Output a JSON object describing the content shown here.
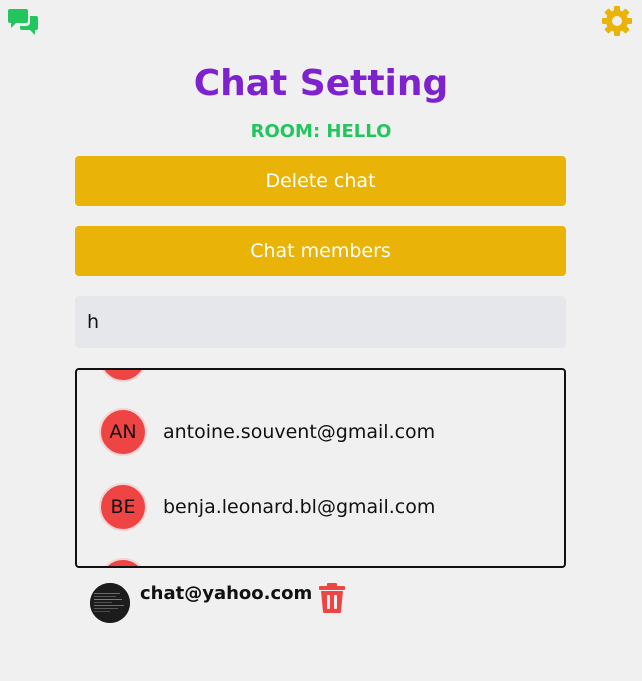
{
  "header": {
    "title": "Chat Setting",
    "room_label": "ROOM: HELLO",
    "left_icon": "chat-bubbles-icon",
    "right_icon": "gear-icon"
  },
  "actions": {
    "delete_label": "Delete chat",
    "members_label": "Chat members"
  },
  "search": {
    "value": "h"
  },
  "members": [
    {
      "initials": "",
      "email": ""
    },
    {
      "initials": "AN",
      "email": "antoine.souvent@gmail.com"
    },
    {
      "initials": "BE",
      "email": "benja.leonard.bl@gmail.com"
    },
    {
      "initials": "",
      "email": ""
    }
  ],
  "current_user": {
    "email": "chat@yahoo.com",
    "action_icon": "trash-icon"
  },
  "colors": {
    "title": "#7e22ce",
    "room": "#22c55e",
    "button": "#eab308",
    "avatar": "#ef4444",
    "trash": "#ef4444",
    "chat_icon": "#22c55e",
    "gear_icon": "#eab308",
    "background": "#f0f0f0"
  }
}
